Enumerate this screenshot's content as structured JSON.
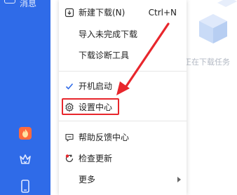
{
  "sidebar": {
    "top_label": "消息",
    "icons": [
      "fire-badge-icon",
      "crown-icon",
      "phone-icon"
    ]
  },
  "main": {
    "empty_text": "正在下载任务"
  },
  "menu": {
    "items": [
      {
        "label": "新建下载(N)",
        "shortcut": "Ctrl+N",
        "icon": "new-download-icon"
      },
      {
        "label": "导入未完成下载"
      },
      {
        "label": "下载诊断工具"
      },
      {
        "label": "开机启动",
        "checked": true
      },
      {
        "label": "设置中心",
        "icon": "gear-icon"
      },
      {
        "label": "帮助反馈中心",
        "icon": "help-feedback-icon"
      },
      {
        "label": "检查更新",
        "icon": "update-icon"
      },
      {
        "label": "更多",
        "has_submenu": true
      }
    ]
  },
  "colors": {
    "sidebar": "#2f6be8",
    "highlight": "#e8262c",
    "check": "#2f6be8"
  }
}
